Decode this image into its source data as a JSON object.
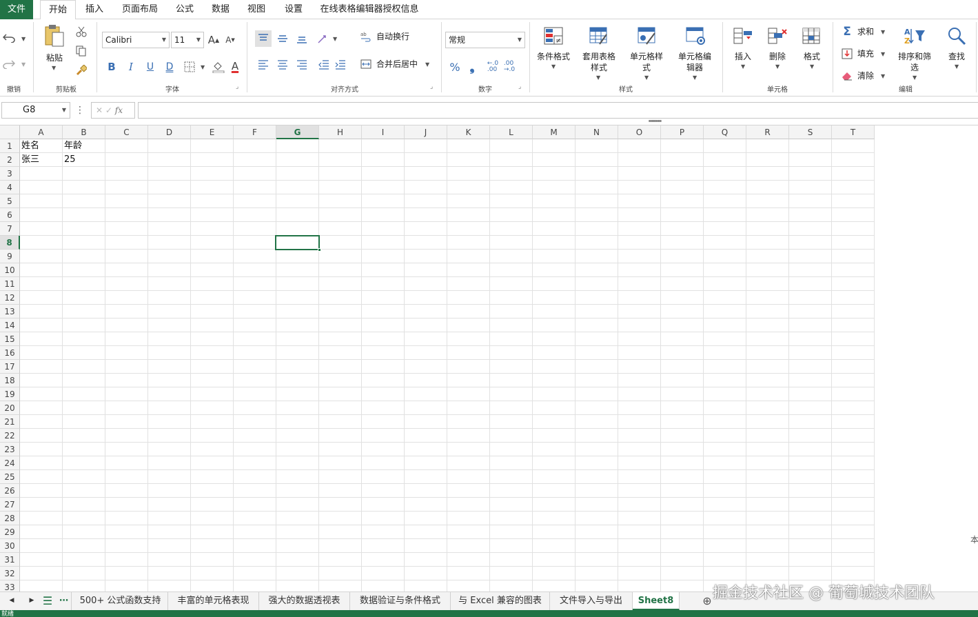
{
  "menu": {
    "tabs": [
      "文件",
      "开始",
      "插入",
      "页面布局",
      "公式",
      "数据",
      "视图",
      "设置",
      "在线表格编辑器授权信息"
    ],
    "active_tab": "开始"
  },
  "ribbon": {
    "undo_group_label": "撤销",
    "clipboard": {
      "paste_label": "粘贴",
      "group_label": "剪贴板"
    },
    "font": {
      "font_name": "Calibri",
      "font_size": "11",
      "bold": "B",
      "italic": "I",
      "underline": "U",
      "double_underline": "D",
      "group_label": "字体"
    },
    "alignment": {
      "wrap_text": "自动换行",
      "merge_center": "合并后居中",
      "group_label": "对齐方式"
    },
    "number": {
      "format": "常规",
      "percent": "%",
      "comma": "❟",
      "group_label": "数字"
    },
    "styles": {
      "conditional_format": "条件格式",
      "table_format_l1": "套用表格",
      "table_format_l2": "样式",
      "cell_style_l1": "单元格样",
      "cell_style_l2": "式",
      "cell_editor_l1": "单元格编",
      "cell_editor_l2": "辑器",
      "group_label": "样式"
    },
    "cells": {
      "insert": "插入",
      "delete": "删除",
      "format": "格式",
      "group_label": "单元格"
    },
    "editing": {
      "sum": "求和",
      "fill": "填充",
      "clear": "清除",
      "sort_filter_l1": "排序和筛",
      "sort_filter_l2": "选",
      "find": "查找",
      "group_label": "编辑"
    }
  },
  "formula_bar": {
    "name_box": "G8",
    "fx": "fx",
    "value": ""
  },
  "grid": {
    "columns": [
      "A",
      "B",
      "C",
      "D",
      "E",
      "F",
      "G",
      "H",
      "I",
      "J",
      "K",
      "L",
      "M",
      "N",
      "O",
      "P",
      "Q",
      "R",
      "S",
      "T"
    ],
    "rows": [
      "1",
      "2",
      "3",
      "4",
      "5",
      "6",
      "7",
      "8",
      "9",
      "10",
      "11",
      "12",
      "13",
      "14",
      "15",
      "16",
      "17",
      "18",
      "19",
      "20",
      "21",
      "22",
      "23",
      "24",
      "25",
      "26",
      "27",
      "28",
      "29",
      "30",
      "31",
      "32",
      "33"
    ],
    "selected_cell": "G8",
    "cells": [
      {
        "ref": "A1",
        "value": "姓名"
      },
      {
        "ref": "B1",
        "value": "年龄"
      },
      {
        "ref": "A2",
        "value": "张三"
      },
      {
        "ref": "B2",
        "value": "25"
      }
    ]
  },
  "sheet_tabs": {
    "tabs": [
      "500+ 公式函数支持",
      "丰富的单元格表现",
      "强大的数据透视表",
      "数据验证与条件格式",
      "与 Excel 兼容的图表",
      "文件导入与导出",
      "Sheet8"
    ],
    "active": "Sheet8"
  },
  "status": {
    "text": "就绪"
  },
  "edge_text": "本",
  "watermark": "掘金技术社区 @ 葡萄城技术团队",
  "colors": {
    "accent": "#217346",
    "gridline": "#e1e1e1"
  }
}
